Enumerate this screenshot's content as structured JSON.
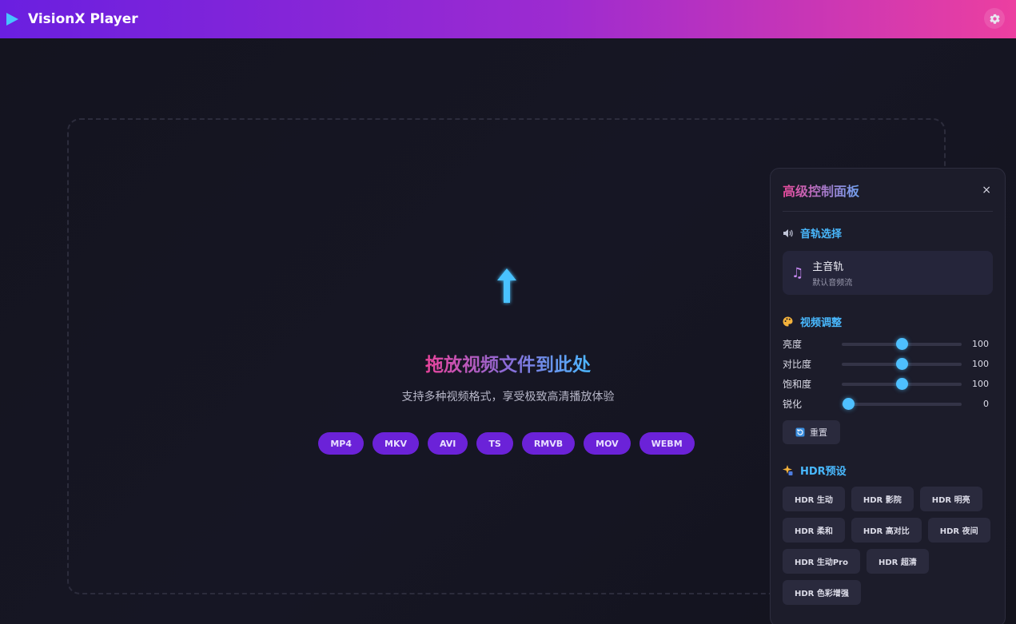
{
  "header": {
    "title": "VisionX Player",
    "settings_icon": "gear-icon"
  },
  "dropzone": {
    "title": "拖放视频文件到此处",
    "subtitle": "支持多种视频格式，享受极致高清播放体验",
    "formats": [
      "MP4",
      "MKV",
      "AVI",
      "TS",
      "RMVB",
      "MOV",
      "WEBM"
    ]
  },
  "panel": {
    "title": "高级控制面板",
    "close_label": "×",
    "audio": {
      "title": "音轨选择",
      "track_name": "主音轨",
      "track_desc": "默认音频流"
    },
    "video": {
      "title": "视频调整",
      "sliders": [
        {
          "label": "亮度",
          "value": "100",
          "fraction": 0.5
        },
        {
          "label": "对比度",
          "value": "100",
          "fraction": 0.5
        },
        {
          "label": "饱和度",
          "value": "100",
          "fraction": 0.5
        },
        {
          "label": "锐化",
          "value": "0",
          "fraction": 0.05
        }
      ],
      "reset_label": "重置"
    },
    "hdr": {
      "title": "HDR预设",
      "presets": [
        "HDR 生动",
        "HDR 影院",
        "HDR 明亮",
        "HDR 柔和",
        "HDR 高对比",
        "HDR 夜间",
        "HDR 生动Pro",
        "HDR 超清",
        "HDR 色彩增强"
      ]
    }
  },
  "colors": {
    "accent": "#4ec0ff",
    "brand_start": "#6a1fe0",
    "brand_end": "#ec3fa0",
    "chip": "#6b22d8"
  }
}
